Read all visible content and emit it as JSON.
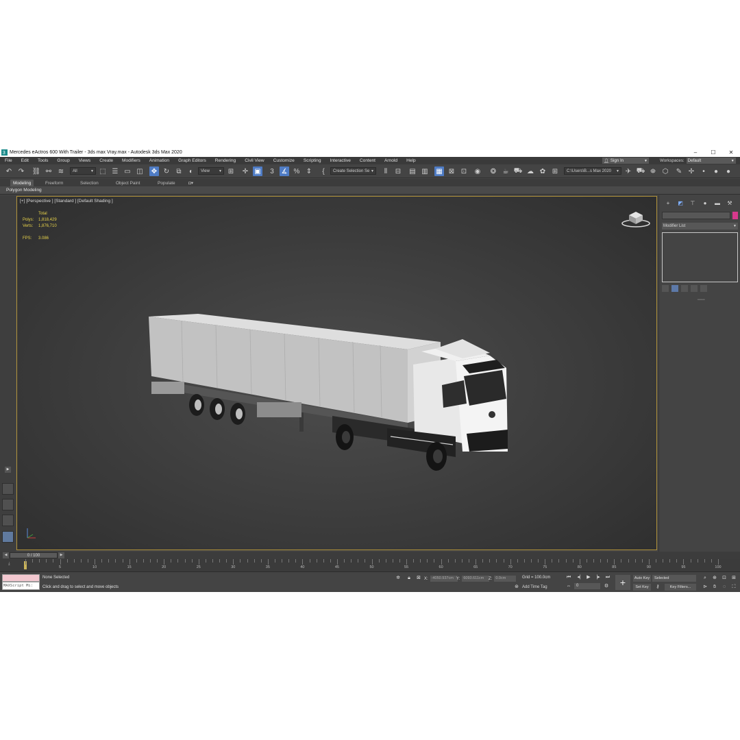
{
  "window": {
    "title": "Mercedes eActros 600 With Trailer - 3ds max Vray.max - Autodesk 3ds Max 2020",
    "controls": [
      "–",
      "☐",
      "✕"
    ]
  },
  "menu": {
    "items": [
      "File",
      "Edit",
      "Tools",
      "Group",
      "Views",
      "Create",
      "Modifiers",
      "Animation",
      "Graph Editors",
      "Rendering",
      "Civil View",
      "Customize",
      "Scripting",
      "Interactive",
      "Content",
      "Arnold",
      "Help"
    ],
    "signin": "Sign In",
    "workspaces_label": "Workspaces:",
    "workspaces_value": "Default"
  },
  "toolbar": {
    "filter": "All",
    "refcoord": "View",
    "selection_set": "Create Selection Se",
    "project_path": "C:\\Users\\B...s Max 2020"
  },
  "ribbon": {
    "tabs": [
      "Modeling",
      "Freeform",
      "Selection",
      "Object Paint",
      "Populate"
    ],
    "active_tab": "Modeling",
    "panel_label": "Polygon Modeling"
  },
  "viewport": {
    "label": "[+] [Perspective ] [Standard ] [Default Shading ]",
    "stats": {
      "header": "Total",
      "polys_label": "Polys:",
      "polys_value": "1,818,429",
      "verts_label": "Verts:",
      "verts_value": "1,876,710",
      "fps_label": "FPS:",
      "fps_value": "3.086"
    },
    "colors": {
      "border": "#b0923a",
      "stats": "#e8d34a"
    }
  },
  "command_panel": {
    "modifier_list": "Modifier List",
    "swatch_color": "#d6398c"
  },
  "time_slider": {
    "value": "0 / 100"
  },
  "trackbar": {
    "ticks": [
      "5",
      "10",
      "15",
      "20",
      "25",
      "30",
      "35",
      "40",
      "45",
      "50",
      "55",
      "60",
      "65",
      "70",
      "75",
      "80",
      "85",
      "90",
      "95",
      "100"
    ]
  },
  "status": {
    "maxscript_label": "MAXScript Mi:",
    "selected_text": "None Selected",
    "hint": "Click and drag to select and move objects",
    "x_label": "X:",
    "x_value": "-4050.937cm",
    "y_label": "Y:",
    "y_value": "6093.611cm",
    "z_label": "Z:",
    "z_value": "0.0cm",
    "grid": "Grid = 100.0cm",
    "add_time_tag": "Add Time Tag",
    "frame": "0",
    "auto_key": "Auto Key",
    "set_key": "Set Key",
    "key_mode": "Selected",
    "key_filters": "Key Filters..."
  }
}
